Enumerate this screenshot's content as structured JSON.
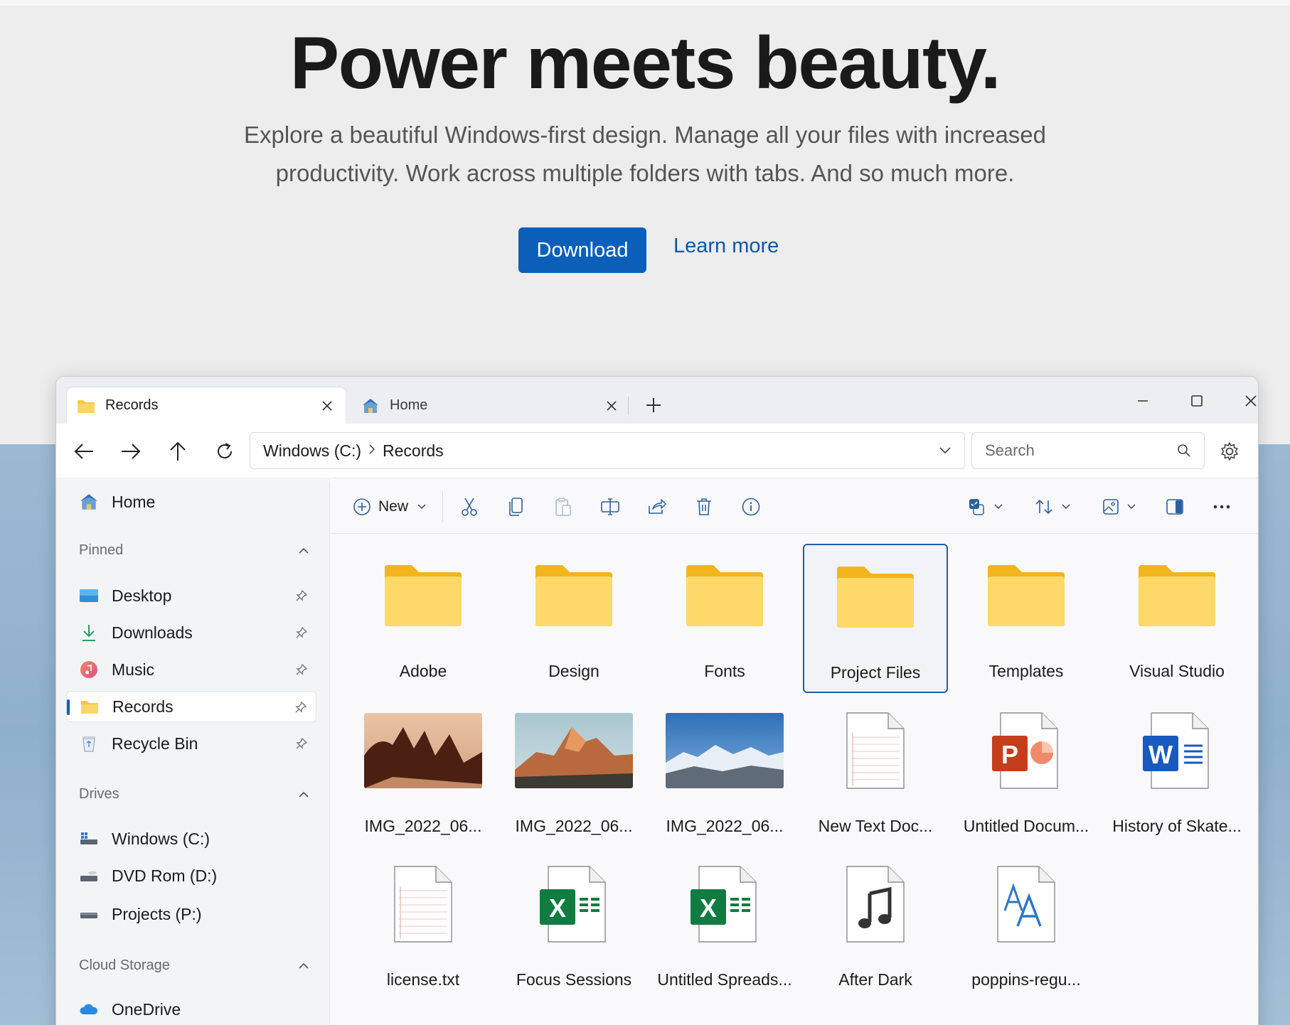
{
  "hero": {
    "title": "Power meets beauty.",
    "subtitle": "Explore a beautiful Windows-first design. Manage all your files with increased productivity. Work across multiple folders with tabs. And so much more.",
    "download_label": "Download",
    "learn_more_label": "Learn more"
  },
  "window": {
    "tabs": [
      {
        "label": "Records",
        "icon": "folder-icon",
        "active": true
      },
      {
        "label": "Home",
        "icon": "home-icon",
        "active": false
      }
    ],
    "address": {
      "drive": "Windows (C:)",
      "folder": "Records"
    },
    "search": {
      "placeholder": "Search"
    },
    "toolbar": {
      "new_label": "New"
    },
    "sidebar": {
      "home": "Home",
      "pinned_header": "Pinned",
      "pinned": [
        {
          "label": "Desktop",
          "icon": "desktop-icon"
        },
        {
          "label": "Downloads",
          "icon": "download-arrow-icon"
        },
        {
          "label": "Music",
          "icon": "music-icon"
        },
        {
          "label": "Records",
          "icon": "folder-icon",
          "selected": true
        },
        {
          "label": "Recycle Bin",
          "icon": "recycle-bin-icon"
        }
      ],
      "drives_header": "Drives",
      "drives": [
        {
          "label": "Windows (C:)",
          "icon": "windows-drive-icon"
        },
        {
          "label": "DVD Rom (D:)",
          "icon": "dvd-drive-icon"
        },
        {
          "label": "Projects (P:)",
          "icon": "drive-icon"
        }
      ],
      "cloud_header": "Cloud Storage",
      "cloud": [
        {
          "label": "OneDrive",
          "icon": "onedrive-icon"
        }
      ]
    },
    "files": [
      {
        "label": "Adobe",
        "type": "folder"
      },
      {
        "label": "Design",
        "type": "folder"
      },
      {
        "label": "Fonts",
        "type": "folder"
      },
      {
        "label": "Project Files",
        "type": "folder",
        "selected": true
      },
      {
        "label": "Templates",
        "type": "folder"
      },
      {
        "label": "Visual Studio",
        "type": "folder"
      },
      {
        "label": "IMG_2022_06...",
        "type": "photo-desert"
      },
      {
        "label": "IMG_2022_06...",
        "type": "photo-mountain"
      },
      {
        "label": "IMG_2022_06...",
        "type": "photo-snow"
      },
      {
        "label": "New Text Doc...",
        "type": "text"
      },
      {
        "label": "Untitled Docum...",
        "type": "powerpoint"
      },
      {
        "label": "History of Skate...",
        "type": "word"
      },
      {
        "label": "license.txt",
        "type": "text"
      },
      {
        "label": "Focus Sessions",
        "type": "excel"
      },
      {
        "label": "Untitled Spreads...",
        "type": "excel"
      },
      {
        "label": "After Dark",
        "type": "audio"
      },
      {
        "label": "poppins-regu...",
        "type": "font"
      }
    ]
  },
  "colors": {
    "accent": "#0b5fb8",
    "folder": "#f7c948",
    "word": "#185abd",
    "excel": "#107c41",
    "powerpoint": "#c43e1c"
  }
}
